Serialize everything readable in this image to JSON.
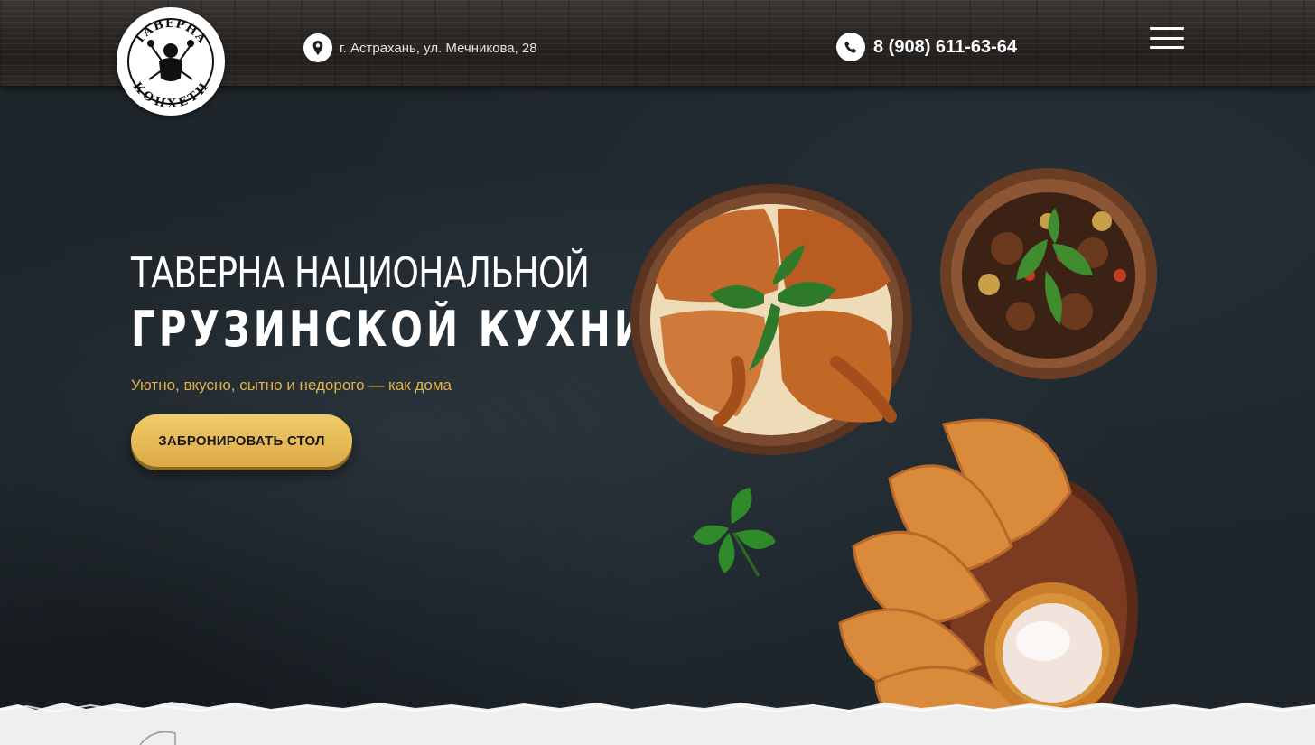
{
  "header": {
    "logo_top": "ТАВЕРНА",
    "logo_bottom": "КОПХЕТИ",
    "address": "г. Астрахань, ул. Мечникова, 28",
    "phone": "8 (908) 611-63-64"
  },
  "hero": {
    "title_line1": "ТАВЕРНА НАЦИОНАЛЬНОЙ",
    "title_line2": "ГРУЗИНСКОЙ КУХНИ",
    "subtitle": "Уютно, вкусно, сытно и недорого — как дома",
    "cta_label": "ЗАБРОНИРОВАТЬ СТОЛ"
  },
  "icons": {
    "address": "map-pin-icon",
    "phone": "phone-icon",
    "menu": "hamburger-menu-icon"
  },
  "colors": {
    "accent_gold": "#e2b24b",
    "button_gold": "#dcaa47",
    "board_dark": "#1e262c"
  }
}
